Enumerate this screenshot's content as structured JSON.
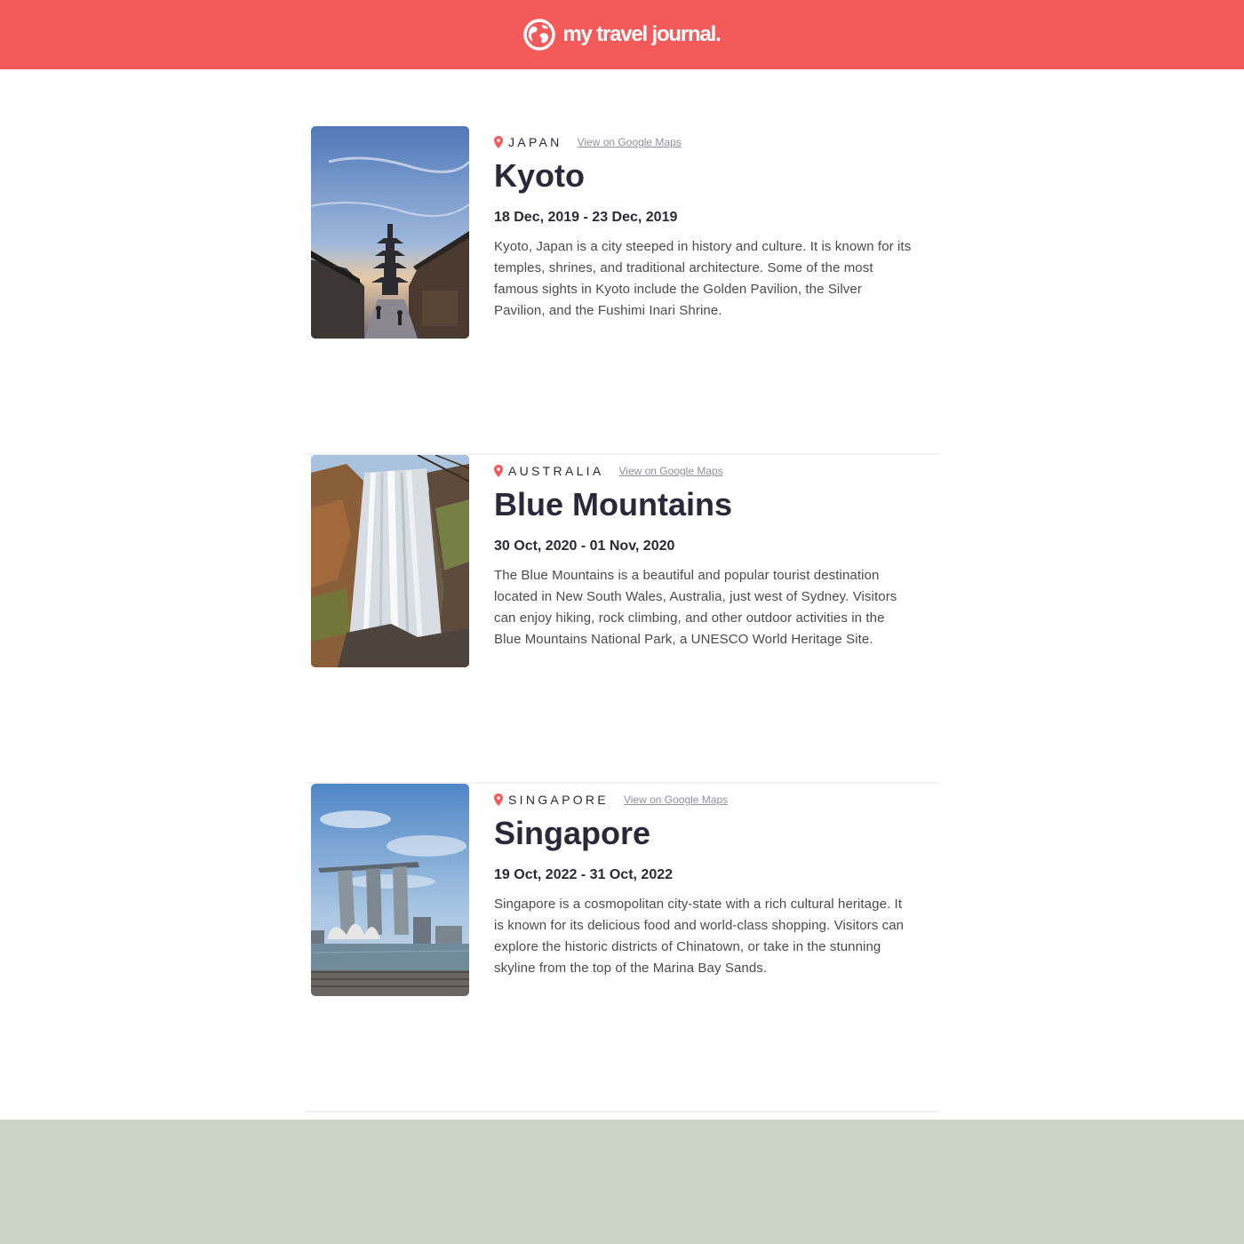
{
  "brand": {
    "name": "my travel journal.",
    "icon": "globe-icon",
    "color": "#F55A5A"
  },
  "entries": [
    {
      "country": "JAPAN",
      "map_link": "View on Google Maps",
      "title": "Kyoto",
      "dates": "18 Dec, 2019 - 23 Dec, 2019",
      "description": "Kyoto, Japan is a city steeped in history and culture. It is known for its temples, shrines, and traditional architecture. Some of the most famous sights in Kyoto include the Golden Pavilion, the Silver Pavilion, and the Fushimi Inari Shrine.",
      "image": "kyoto-pagoda-photo"
    },
    {
      "country": "AUSTRALIA",
      "map_link": "View on Google Maps",
      "title": "Blue Mountains",
      "dates": "30 Oct, 2020 - 01 Nov, 2020",
      "description": "The Blue Mountains is a beautiful and popular tourist destination located in New South Wales, Australia, just west of Sydney. Visitors can enjoy hiking, rock climbing, and other outdoor activities in the Blue Mountains National Park, a UNESCO World Heritage Site.",
      "image": "waterfall-photo"
    },
    {
      "country": "SINGAPORE",
      "map_link": "View on Google Maps",
      "title": "Singapore",
      "dates": "19 Oct, 2022 - 31 Oct, 2022",
      "description": "Singapore is a cosmopolitan city-state with a rich cultural heritage. It is known for its delicious food and world-class shopping. Visitors can explore the historic districts of Chinatown, or take in the stunning skyline from the top of the Marina Bay Sands.",
      "image": "marina-bay-photo"
    }
  ],
  "colors": {
    "footer": "#CBD5C4",
    "pin": "#F55A5A",
    "link": "#918E9B"
  }
}
